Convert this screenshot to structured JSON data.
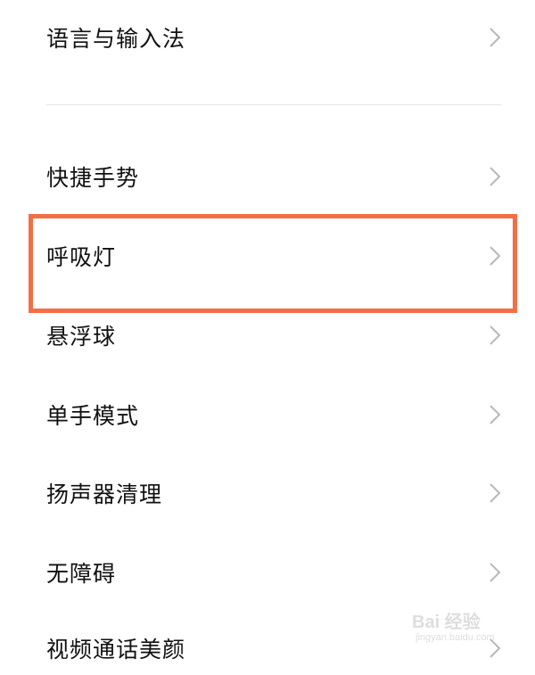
{
  "settings_list": {
    "items": [
      {
        "label": "语言与输入法",
        "chevron": "chevron-right-icon"
      },
      {
        "label": "快捷手势",
        "chevron": "chevron-right-icon"
      },
      {
        "label": "呼吸灯",
        "chevron": "chevron-right-icon",
        "highlighted": true
      },
      {
        "label": "悬浮球",
        "chevron": "chevron-right-icon"
      },
      {
        "label": "单手模式",
        "chevron": "chevron-right-icon"
      },
      {
        "label": "扬声器清理",
        "chevron": "chevron-right-icon"
      },
      {
        "label": "无障碍",
        "chevron": "chevron-right-icon"
      },
      {
        "label": "视频通话美颜",
        "chevron": "chevron-right-icon"
      }
    ]
  },
  "colors": {
    "highlight_border": "#f26f46",
    "text": "#111111",
    "chevron": "#b8b8b8",
    "divider": "#e6e6e6",
    "background": "#ffffff"
  },
  "watermark": {
    "brand": "Bai 经验",
    "sub": "jingyan.baidu.com"
  }
}
